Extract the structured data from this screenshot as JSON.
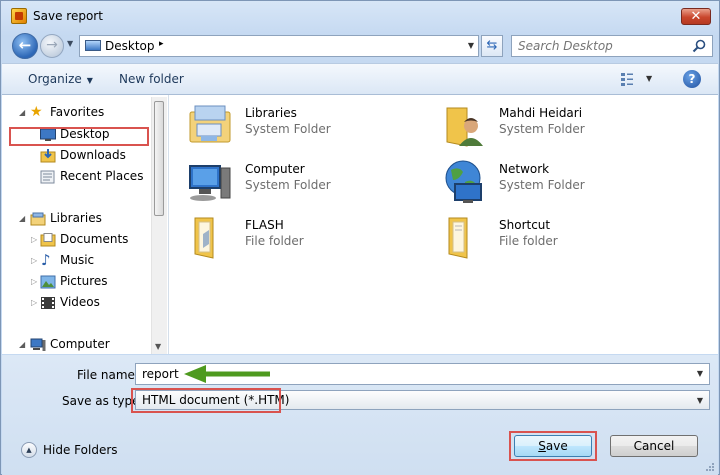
{
  "window": {
    "title": "Save report",
    "close_label": "✕"
  },
  "navigation": {
    "back_glyph": "←",
    "forward_glyph": "→",
    "address": {
      "location": "Desktop",
      "separator": "▸"
    },
    "refresh_glyph": "⇆",
    "search": {
      "placeholder": "Search Desktop"
    }
  },
  "toolbar": {
    "organize_label": "Organize",
    "new_folder_label": "New folder",
    "help_label": "?"
  },
  "sidebar": {
    "favorites": {
      "label": "Favorites",
      "items": [
        {
          "label": "Desktop",
          "icon": "desktop-icon",
          "selected": true
        },
        {
          "label": "Downloads",
          "icon": "downloads-icon"
        },
        {
          "label": "Recent Places",
          "icon": "recent-places-icon"
        }
      ]
    },
    "libraries": {
      "label": "Libraries",
      "items": [
        {
          "label": "Documents",
          "icon": "documents-icon"
        },
        {
          "label": "Music",
          "icon": "music-icon"
        },
        {
          "label": "Pictures",
          "icon": "pictures-icon"
        },
        {
          "label": "Videos",
          "icon": "videos-icon"
        }
      ]
    },
    "computer": {
      "label": "Computer"
    }
  },
  "files": [
    {
      "name": "Libraries",
      "type": "System Folder",
      "icon": "libraries-icon"
    },
    {
      "name": "Mahdi Heidari",
      "type": "System Folder",
      "icon": "user-folder-icon"
    },
    {
      "name": "Computer",
      "type": "System Folder",
      "icon": "computer-icon"
    },
    {
      "name": "Network",
      "type": "System Folder",
      "icon": "network-icon"
    },
    {
      "name": "FLASH",
      "type": "File folder",
      "icon": "folder-icon"
    },
    {
      "name": "Shortcut",
      "type": "File folder",
      "icon": "folder-icon"
    }
  ],
  "form": {
    "file_name_label": "File name:",
    "file_name_value": "report",
    "save_type_label": "Save as type:",
    "save_type_value": "HTML document (*.HTM)"
  },
  "footer": {
    "hide_folders_label": "Hide Folders",
    "save_label": "ave",
    "save_accel": "S",
    "cancel_label": "Cancel"
  },
  "colors": {
    "highlight": "#d9534f",
    "arrow": "#4e9a1f",
    "accent": "#2d67b6"
  }
}
